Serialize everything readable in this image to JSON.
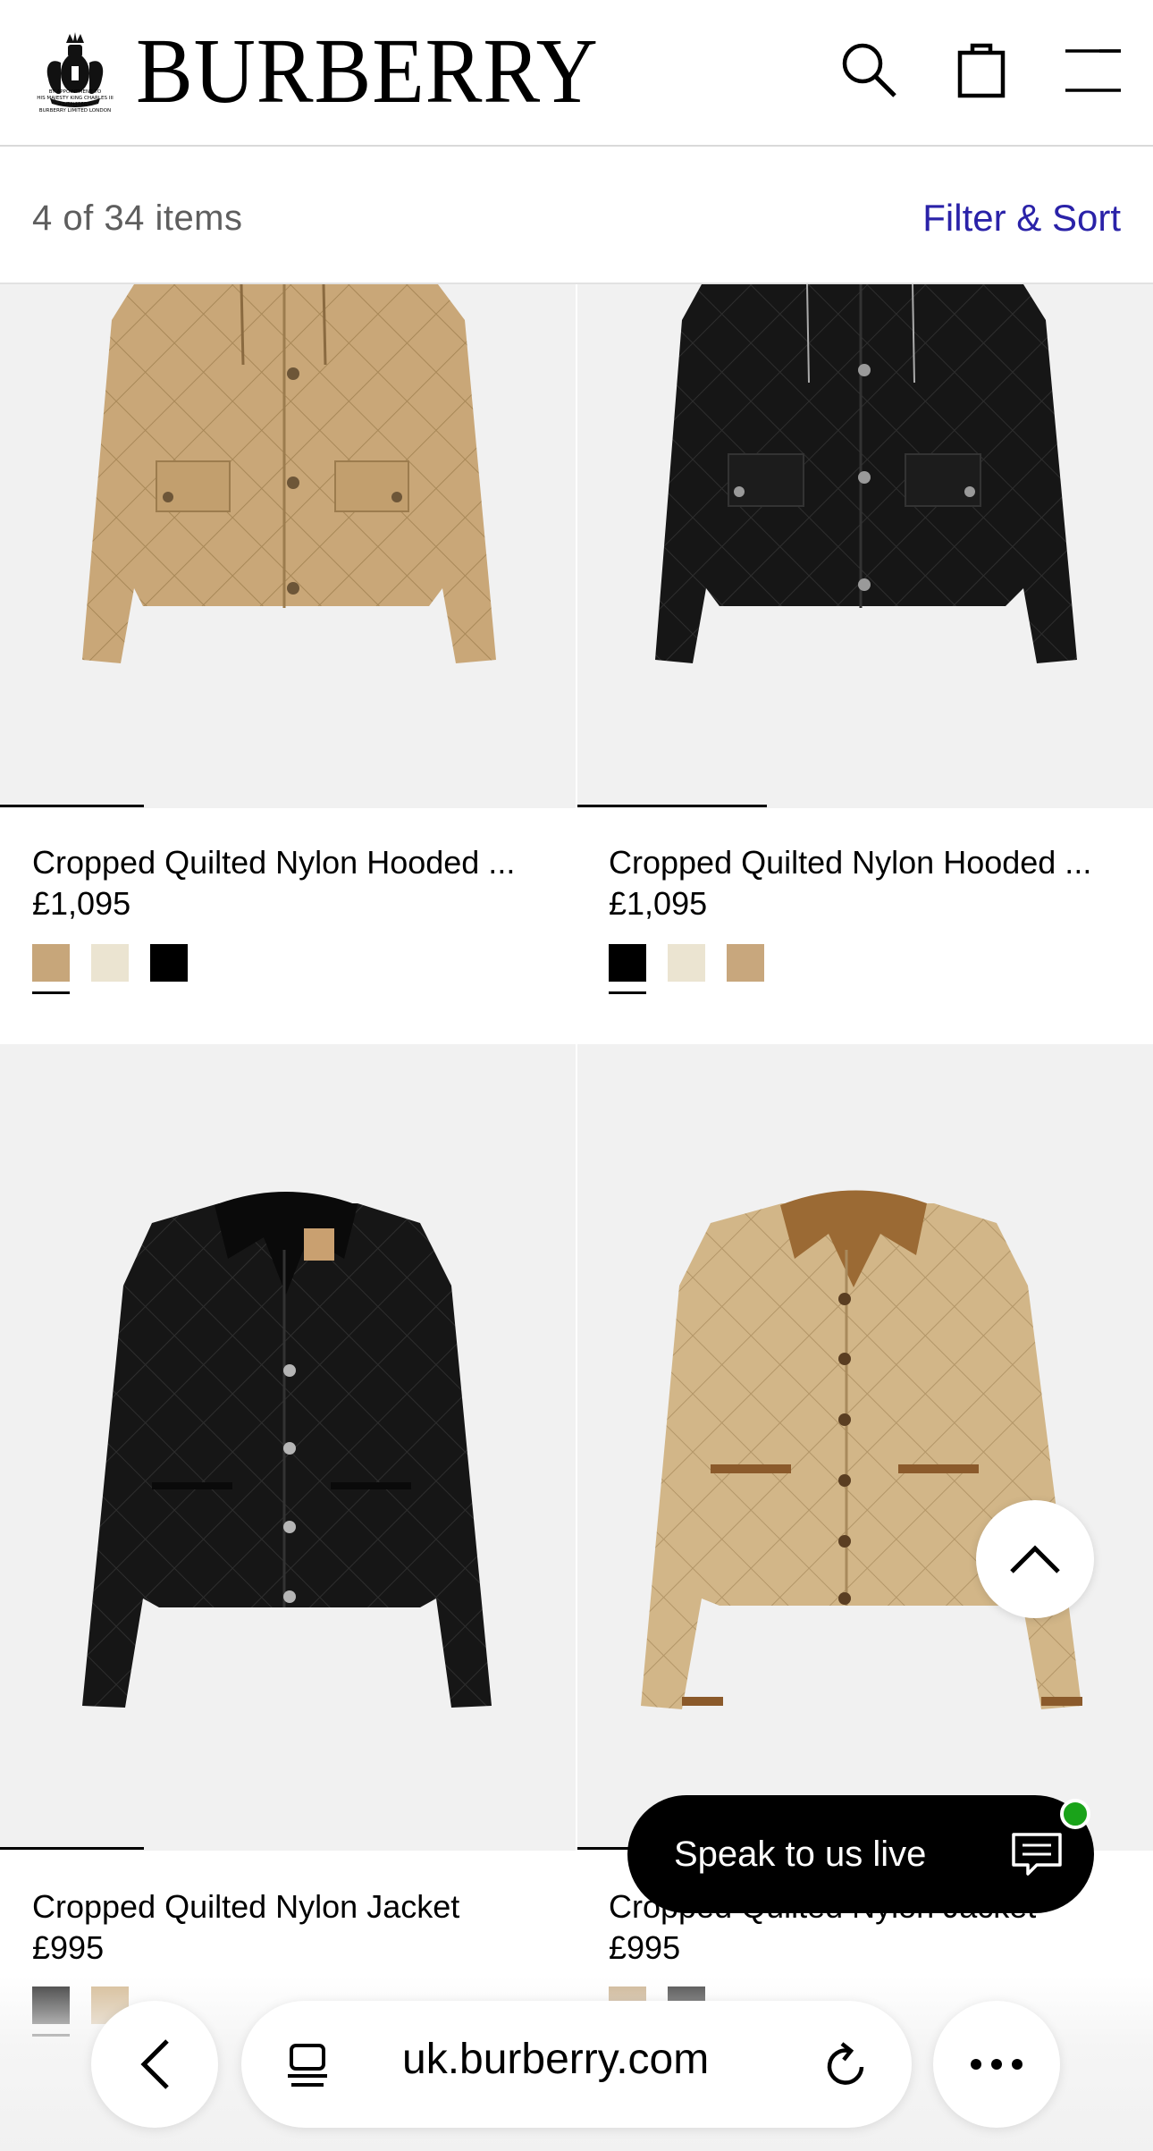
{
  "header": {
    "brand": "BURBERRY",
    "warrant_text": "BY APPOINTMENT TO\nHIS MAJESTY KING CHARLES III\nOUTFITTERS\nBURBERRY LIMITED LONDON",
    "icons": [
      "search-icon",
      "shopping-bag-icon",
      "menu-icon"
    ]
  },
  "filterbar": {
    "count": "4  of 34 items",
    "filter_label": "Filter & Sort"
  },
  "products": [
    {
      "title": "Cropped Quilted Nylon Hooded ...",
      "price": "£1,095",
      "swatches": [
        "#c7a67a",
        "#ebe4d1",
        "#000000"
      ],
      "selected_swatch": 0,
      "image_progress": 0.25,
      "jacket_color": "#c9a778"
    },
    {
      "title": "Cropped Quilted Nylon Hooded ...",
      "price": "£1,095",
      "swatches": [
        "#000000",
        "#ebe4d1",
        "#c8a77d"
      ],
      "selected_swatch": 0,
      "image_progress": 0.33,
      "jacket_color": "#161616"
    },
    {
      "title": "Cropped Quilted Nylon Jacket",
      "price": "£995",
      "swatches": [
        "#3a3a3a",
        "#d6bc96"
      ],
      "selected_swatch": 0,
      "image_progress": 0.25,
      "jacket_color": "#161616"
    },
    {
      "title": "Cropped Quilted Nylon Jacket",
      "price": "£995",
      "swatches": [
        "#cdb594",
        "#4a4a4a"
      ],
      "selected_swatch": 0,
      "image_progress": 0.25,
      "jacket_color": "#d2b688"
    }
  ],
  "chat": {
    "label": "Speak to us live",
    "status_color": "#1aa31a"
  },
  "browser": {
    "url": "uk.burberry.com"
  },
  "colors": {
    "link": "#2a22a8",
    "image_bg": "#f1f1f1"
  }
}
